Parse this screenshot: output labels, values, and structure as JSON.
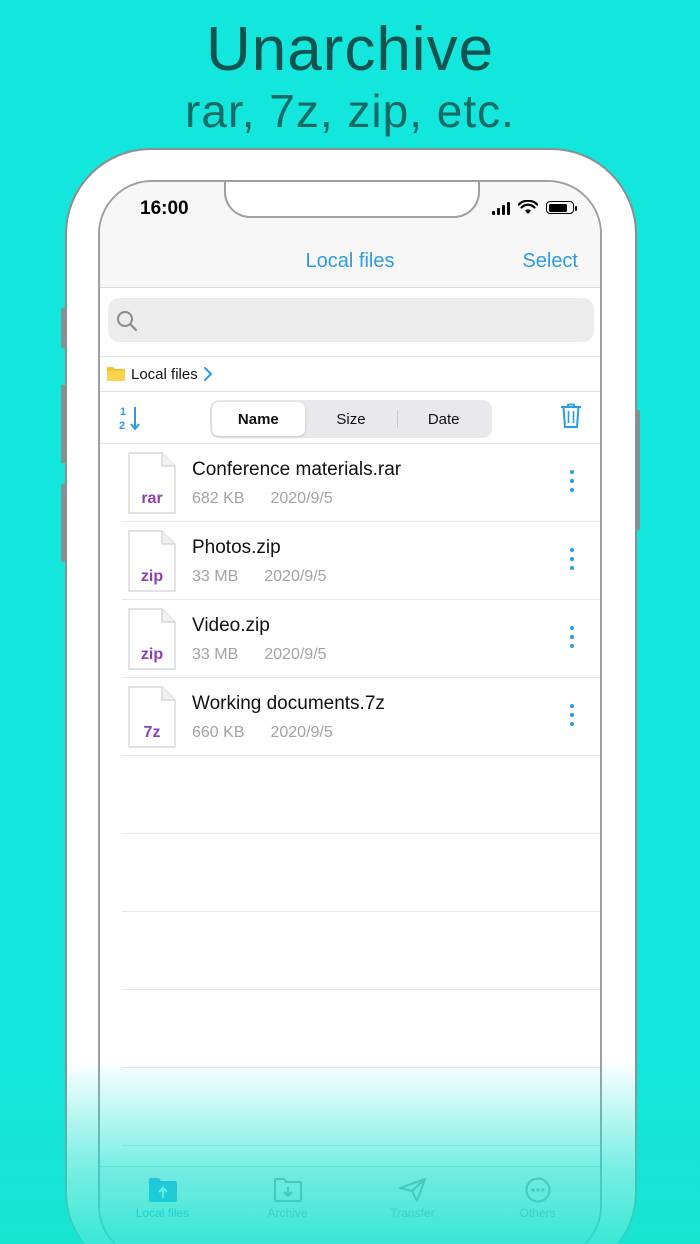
{
  "headline": {
    "line1": "Unarchive",
    "line2": "rar, 7z, zip, etc."
  },
  "status": {
    "time": "16:00"
  },
  "navbar": {
    "title": "Local files",
    "select_label": "Select"
  },
  "search": {
    "placeholder": ""
  },
  "breadcrumb": {
    "label": "Local files"
  },
  "sort": {
    "options": [
      "Name",
      "Size",
      "Date"
    ],
    "active": "Name"
  },
  "files": [
    {
      "ext": "rar",
      "name": "Conference materials.rar",
      "size": "682 KB",
      "date": "2020/9/5"
    },
    {
      "ext": "zip",
      "name": "Photos.zip",
      "size": "33 MB",
      "date": "2020/9/5"
    },
    {
      "ext": "zip",
      "name": "Video.zip",
      "size": "33 MB",
      "date": "2020/9/5"
    },
    {
      "ext": "7z",
      "name": "Working documents.7z",
      "size": "660 KB",
      "date": "2020/9/5"
    }
  ],
  "tabs": [
    {
      "label": "Local files",
      "icon": "folder-upload-icon",
      "active": true
    },
    {
      "label": "Archive",
      "icon": "folder-download-icon",
      "active": false
    },
    {
      "label": "Transfer",
      "icon": "paper-plane-icon",
      "active": false
    },
    {
      "label": "Others",
      "icon": "more-circle-icon",
      "active": false
    }
  ],
  "colors": {
    "background": "#13e6dc",
    "accent": "#2b9be6",
    "extension": "#8e3fb0",
    "headline": "#11544f"
  }
}
